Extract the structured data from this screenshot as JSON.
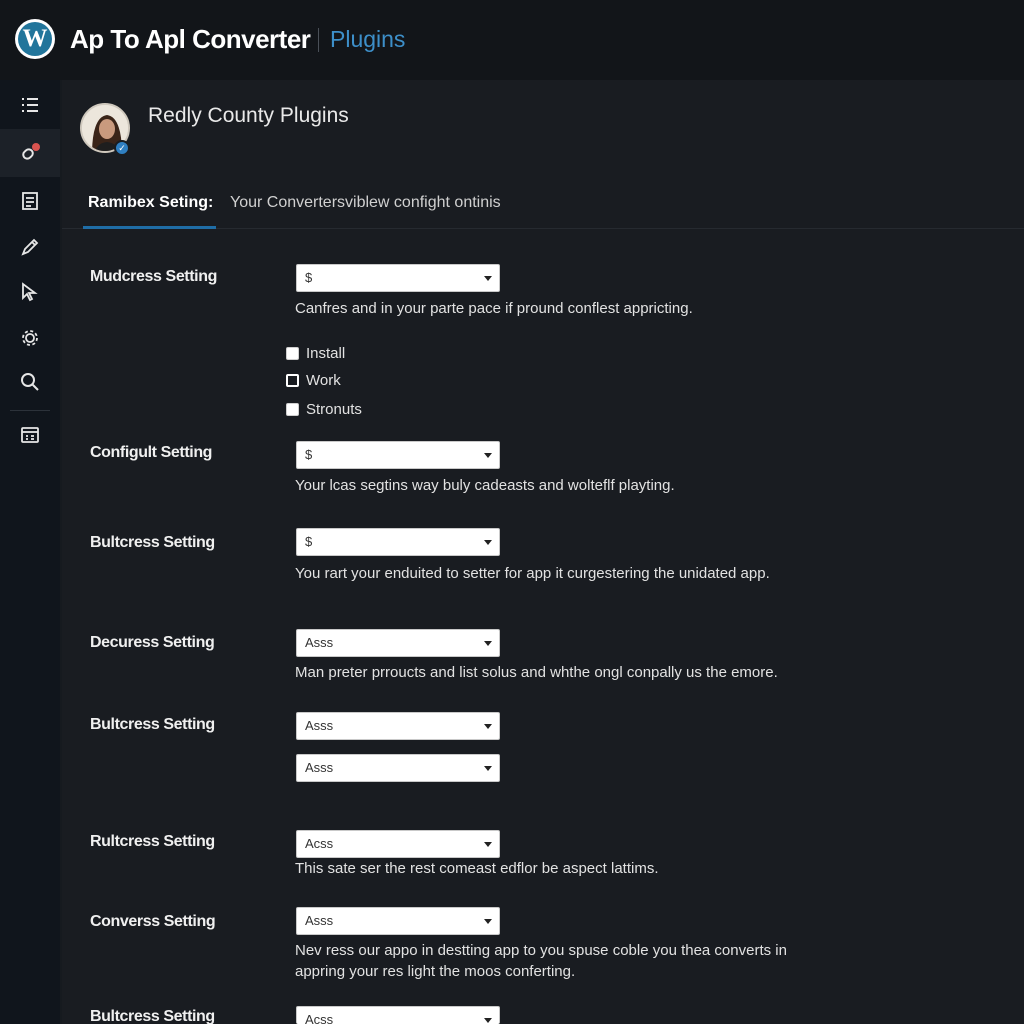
{
  "header": {
    "logo_glyph": "W",
    "title": "Ap To Apl Converter",
    "section": "Plugins",
    "accent": "#3d8fc9"
  },
  "sidebar": {
    "items": [
      {
        "icon": "list-icon"
      },
      {
        "icon": "plugin-icon",
        "active": true
      },
      {
        "icon": "document-icon"
      },
      {
        "icon": "pencil-icon"
      },
      {
        "icon": "cursor-icon"
      },
      {
        "icon": "gear-icon"
      },
      {
        "icon": "search-icon"
      },
      {
        "icon": "dashboard-icon"
      }
    ]
  },
  "profile": {
    "site_name": "Redly County Plugins"
  },
  "tabs": {
    "active": "Ramibex Seting:",
    "description": "Your Convertersviblew confight ontinis"
  },
  "settings": [
    {
      "label": "Mudcress Setting",
      "value": "$",
      "help": "Canfres and in your parte pace if pround conflest appricting."
    },
    {
      "label": "Configult Setting",
      "value": "$",
      "help": "Your lcas segtins way buly cadeasts and wolteflf playting."
    },
    {
      "label": "Bultcress Setting",
      "value": "$",
      "help": "You rart your enduited to setter for app it curgestering the unidated app."
    },
    {
      "label": "Decuress Setting",
      "value": "Asss",
      "help": "Man preter prroucts and list solus and whthe ongl conpally us the emore."
    },
    {
      "label": "Bultcress Setting",
      "value": "Asss",
      "value2": "Asss",
      "help": ""
    },
    {
      "label": "Rultcress Setting",
      "value": "Acss",
      "help": "This sate ser the rest comeast edflor be aspect lattims."
    },
    {
      "label": "Converss Setting",
      "value": "Asss",
      "help": "Nev ress our appo in destting app to you spuse coble you thea converts in appring your res light the moos conferting."
    },
    {
      "label": "Bultcress Setting",
      "value": "Acss",
      "help": ""
    }
  ],
  "checkboxes": [
    {
      "label": "Install",
      "checked": true
    },
    {
      "label": "Work",
      "checked": false
    },
    {
      "label": "Stronuts",
      "checked": true
    }
  ]
}
